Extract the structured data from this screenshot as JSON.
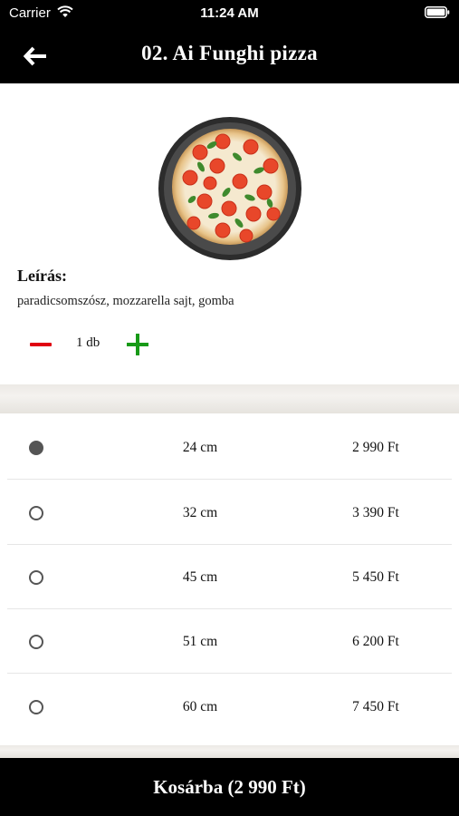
{
  "status_bar": {
    "carrier": "Carrier",
    "time": "11:24 AM"
  },
  "nav": {
    "back_icon": "arrow-left-icon",
    "title": "02. Ai Funghi pizza"
  },
  "product": {
    "image": "pizza-image",
    "description_label": "Leírás:",
    "description": "paradicsomszósz, mozzarella sajt, gomba",
    "quantity_text": "1 db",
    "quantity": 1
  },
  "sizes": [
    {
      "size": "24 cm",
      "price": "2 990 Ft",
      "selected": true
    },
    {
      "size": "32 cm",
      "price": "3 390 Ft",
      "selected": false
    },
    {
      "size": "45 cm",
      "price": "5 450 Ft",
      "selected": false
    },
    {
      "size": "51 cm",
      "price": "6 200 Ft",
      "selected": false
    },
    {
      "size": "60 cm",
      "price": "7 450 Ft",
      "selected": false
    }
  ],
  "cart_button": {
    "label": "Kosárba (2 990 Ft)"
  },
  "colors": {
    "header_bg": "#000000",
    "minus": "#e00012",
    "plus": "#179a17"
  }
}
